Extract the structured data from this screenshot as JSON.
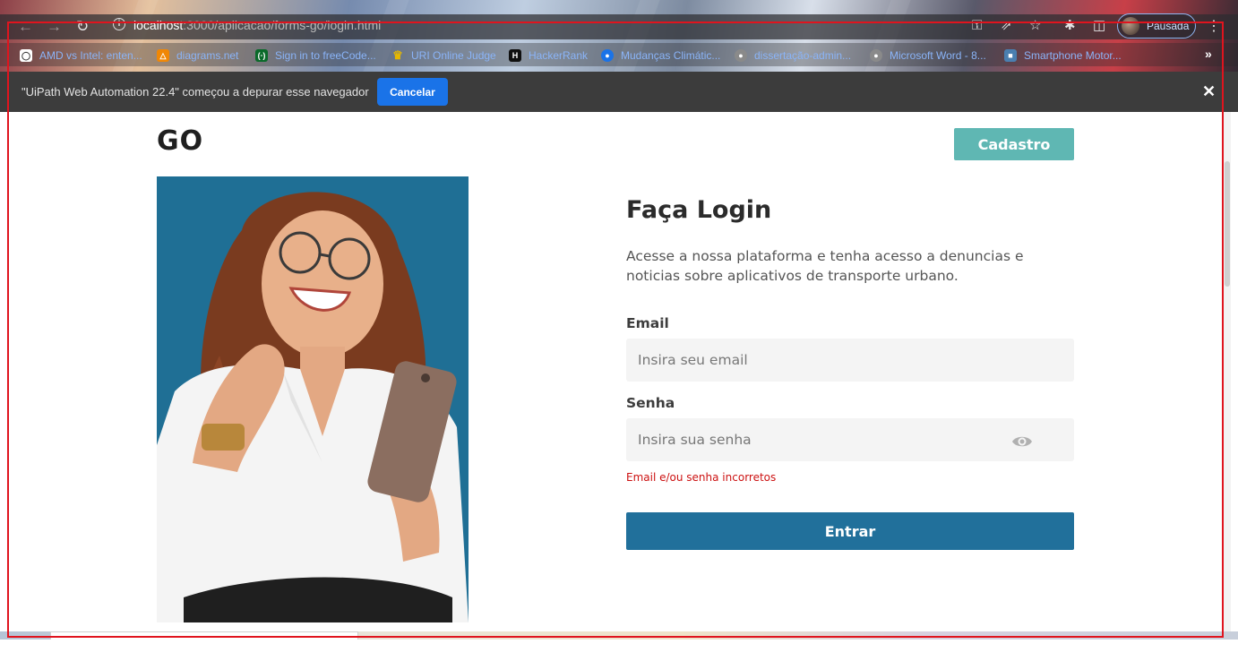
{
  "browser": {
    "url_host": "localhost",
    "url_path": ":3000/aplicacao/forms-go/login.html",
    "profile_label": "Pausada",
    "bookmarks": [
      {
        "label": "AMD vs Intel: enten...",
        "icon": "shield-icon",
        "color": "#ffffff"
      },
      {
        "label": "diagrams.net",
        "icon": "diagram-icon",
        "color": "#f08705"
      },
      {
        "label": "Sign in to freeCode...",
        "icon": "freecodecamp-icon",
        "color": "#0a6a2a"
      },
      {
        "label": "URI Online Judge",
        "icon": "trophy-icon",
        "color": "#d9a400"
      },
      {
        "label": "HackerRank",
        "icon": "hackerrank-icon",
        "color": "#101010"
      },
      {
        "label": "Mudanças Climátic...",
        "icon": "globe-icon",
        "color": "#1a73e8"
      },
      {
        "label": "dissertação-admin...",
        "icon": "web-icon",
        "color": "#8a8a8a"
      },
      {
        "label": "Microsoft Word - 8...",
        "icon": "web-icon",
        "color": "#8a8a8a"
      },
      {
        "label": "Smartphone Motor...",
        "icon": "photo-icon",
        "color": "#4a7fb0"
      }
    ]
  },
  "infobar": {
    "message": "\"UiPath Web Automation 22.4\" começou a depurar esse navegador",
    "cancel_label": "Cancelar"
  },
  "page": {
    "logo": "GO",
    "signup_label": "Cadastro",
    "title": "Faça Login",
    "description": "Acesse a nossa plataforma e tenha acesso a denuncias e noticias sobre aplicativos de transporte urbano.",
    "email_label": "Email",
    "email_placeholder": "Insira seu email",
    "password_label": "Senha",
    "password_placeholder": "Insira sua senha",
    "error_message": "Email e/ou senha incorretos",
    "submit_label": "Entrar"
  },
  "colors": {
    "accent_teal": "#5fb7b3",
    "primary_blue": "#21709b",
    "error_red": "#cc1111",
    "hero_background": "#1f6f95"
  }
}
